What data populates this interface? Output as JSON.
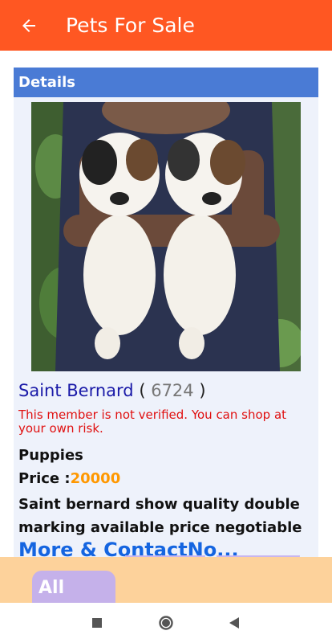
{
  "appbar": {
    "title": "Pets For Sale",
    "back_icon": "arrow-back-icon",
    "color": "#ff5722"
  },
  "details": {
    "header": "Details",
    "image_alt": "two saint bernard puppies held in hands",
    "breed": "Saint Bernard",
    "id_open": "(",
    "listing_id": "6724",
    "id_close": ")",
    "warning": "This member is not verified. You can shop at your own risk.",
    "category": "Puppies",
    "price_label": "Price :",
    "price_value": "20000",
    "description": "Saint bernard show quality double marking available price negotiable",
    "more_link": "More & ContactNo..."
  },
  "bottom": {
    "chip_label": "All"
  },
  "system_nav": {
    "recents_icon": "square-icon",
    "home_icon": "circle-icon",
    "back_icon": "triangle-back-icon"
  }
}
